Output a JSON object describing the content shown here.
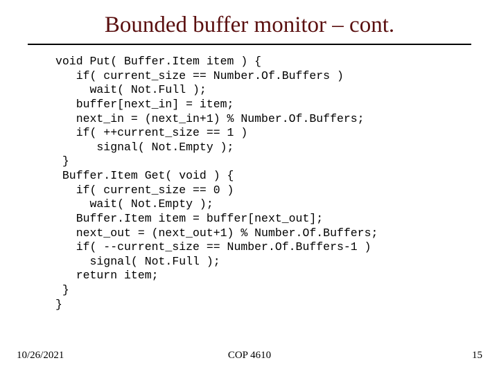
{
  "title": "Bounded buffer monitor – cont.",
  "code": "void Put( Buffer.Item item ) {\n   if( current_size == Number.Of.Buffers )\n     wait( Not.Full );\n   buffer[next_in] = item;\n   next_in = (next_in+1) % Number.Of.Buffers;\n   if( ++current_size == 1 )\n      signal( Not.Empty );\n }\n Buffer.Item Get( void ) {\n   if( current_size == 0 )\n     wait( Not.Empty );\n   Buffer.Item item = buffer[next_out];\n   next_out = (next_out+1) % Number.Of.Buffers;\n   if( --current_size == Number.Of.Buffers-1 )\n     signal( Not.Full );\n   return item;\n }\n}",
  "footer": {
    "date": "10/26/2021",
    "course": "COP 4610",
    "page": "15"
  }
}
